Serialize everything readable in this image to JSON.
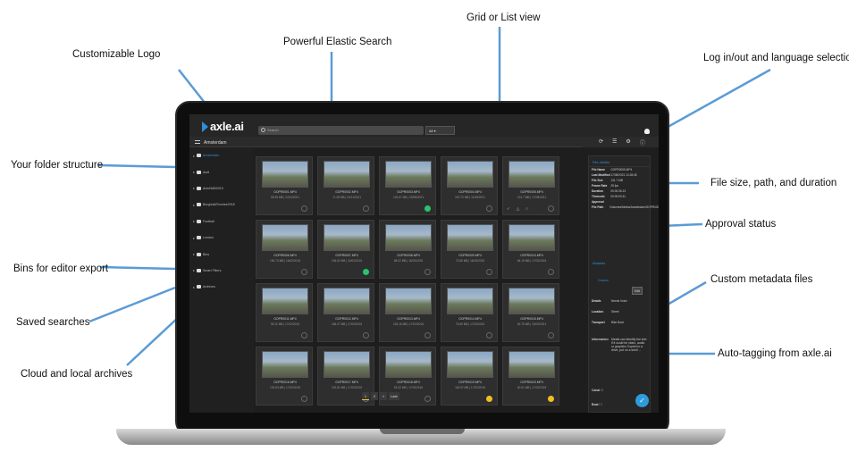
{
  "annotations": {
    "logo": "Customizable Logo",
    "search": "Powerful Elastic Search",
    "view": "Grid or List view",
    "login": "Log in/out and language selection",
    "folders": "Your folder structure",
    "filesize": "File size, path, and duration",
    "approval": "Approval status",
    "bins": "Bins for editor export",
    "custom_meta": "Custom metadata files",
    "saved": "Saved searches",
    "autotag": "Auto-tagging from axle.ai",
    "cloud": "Cloud and local archives"
  },
  "app": {
    "logo": "axle.ai",
    "search_placeholder": "Search",
    "scope": "All",
    "breadcrumb": "Amsterdam",
    "accent": "#2d8fd9"
  },
  "sidebar": {
    "items": [
      {
        "label": "Amsterdam",
        "active": true
      },
      {
        "label": "Audi"
      },
      {
        "label": "AutoNAB2019"
      },
      {
        "label": "Burghold/Sunrise2018"
      },
      {
        "label": "Football"
      },
      {
        "label": "London"
      },
      {
        "label": "Bins"
      },
      {
        "label": "Smart Filters"
      },
      {
        "label": "Archives"
      }
    ]
  },
  "grid": {
    "cards": [
      {
        "name": "GOPR0001.MP4",
        "meta": "55.95 MB | 24/11/2021"
      },
      {
        "name": "GOPR0002.MP4",
        "meta": "71.08 MB | 24/11/2021"
      },
      {
        "name": "GOPR0003.MP4",
        "meta": "120.67 MB | 03/08/2021",
        "status": "green"
      },
      {
        "name": "GOPR0004.MP4",
        "meta": "220.72 MB | 11/08/2021"
      },
      {
        "name": "GOPR0005.MP4",
        "meta": "131.7 MB | 17/08/2021",
        "icons": true
      },
      {
        "name": "GOPR0006.MP4",
        "meta": "150.73 MB | 16/02/2015"
      },
      {
        "name": "GOPR0007.MP4",
        "meta": "106.52 MB | 16/02/2015",
        "status": "green"
      },
      {
        "name": "GOPR0008.MP4",
        "meta": "85.02 MB | 16/02/2015"
      },
      {
        "name": "GOPR0009.MP4",
        "meta": "73.65 MB | 16/02/2015"
      },
      {
        "name": "GOPR0010.MP4",
        "meta": "64.15 MB | 17/02/2015"
      },
      {
        "name": "GOPR0011.MP4",
        "meta": "95.11 MB | 17/02/2015"
      },
      {
        "name": "GOPR0012.MP4",
        "meta": "156.27 MB | 17/02/2015"
      },
      {
        "name": "GOPR0013.MP4",
        "meta": "153.15 MB | 17/02/2015"
      },
      {
        "name": "GOPR0014.MP4",
        "meta": "75.69 MB | 17/02/2015"
      },
      {
        "name": "GOPR0015.MP4",
        "meta": "82.75 MB | 10/02/2021"
      },
      {
        "name": "GOPR0016.MP4",
        "meta": "133.53 MB | 17/02/2015"
      },
      {
        "name": "GOPR0017.MP4",
        "meta": "102.81 MB | 17/02/2015"
      },
      {
        "name": "GOPR0018.MP4",
        "meta": "92.02 MB | 17/02/2015"
      },
      {
        "name": "GOPR0019.MP4",
        "meta": "118.57 MB | 17/02/2015",
        "status": "yellow"
      },
      {
        "name": "GOPR0020.MP4",
        "meta": "60.51 MB | 17/02/2015",
        "status": "yellow"
      }
    ]
  },
  "pager": {
    "p1": "1",
    "p2": "2",
    "next": "»",
    "last": "Last"
  },
  "panel": {
    "title": "File details",
    "fields": [
      {
        "k": "File Name",
        "v": "GOPR0005.MP4"
      },
      {
        "k": "Last Modified",
        "v": "17/08/2021 13:28:45"
      },
      {
        "k": "File Size",
        "v": "131.7 MB"
      },
      {
        "k": "Frame Rate",
        "v": "25 fps"
      },
      {
        "k": "Duration",
        "v": "00:00:36.13"
      },
      {
        "k": "Timecode",
        "v": "00:00:00:11"
      },
      {
        "k": "Approval",
        "v": ""
      },
      {
        "k": "File Path",
        "v": "/Volumes/Media/Amsterdam/GOPR0005.MP4"
      }
    ],
    "meta_title": "Metadata",
    "custom": "Custom",
    "edit": "Edit",
    "rows": [
      {
        "k": "Details",
        "v": "Needs Voice"
      },
      {
        "k": "Location",
        "v": "Street"
      },
      {
        "k": "Transport",
        "v": "Bike  Boat"
      }
    ],
    "info_k": "Information",
    "info_v": "Media can identify the text if it could be video, audio or graphics Copied to a drive, put on a shelf ...",
    "canal": "Canal",
    "boat": "Boat"
  }
}
